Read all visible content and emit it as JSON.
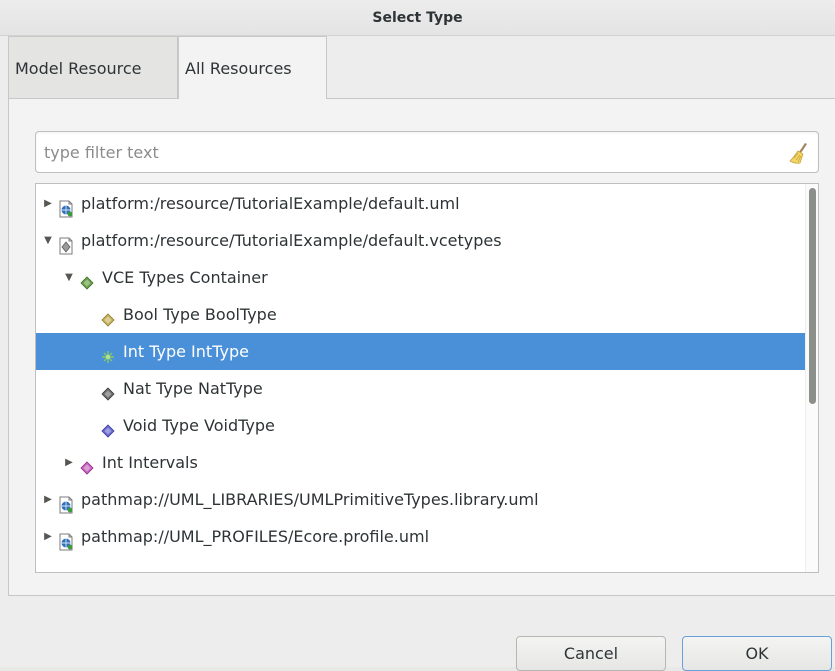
{
  "window": {
    "title": "Select Type"
  },
  "tabs": [
    {
      "label": "Model Resource",
      "active": false
    },
    {
      "label": "All Resources",
      "active": true
    }
  ],
  "filter": {
    "placeholder": "type filter text",
    "value": ""
  },
  "tree": {
    "rows": [
      {
        "label": "platform:/resource/TutorialExample/default.uml",
        "depth": 0,
        "expander": "collapsed",
        "icon": "uml-resource-icon"
      },
      {
        "label": "platform:/resource/TutorialExample/default.vcetypes",
        "depth": 0,
        "expander": "expanded",
        "icon": "vcetypes-resource-icon"
      },
      {
        "label": "VCE Types Container",
        "depth": 1,
        "expander": "expanded",
        "icon": "types-container-icon"
      },
      {
        "label": "Bool Type BoolType",
        "depth": 2,
        "expander": "none",
        "icon": "bool-type-icon"
      },
      {
        "label": "Int Type IntType",
        "depth": 2,
        "expander": "none",
        "icon": "int-type-icon",
        "selected": true
      },
      {
        "label": "Nat Type NatType",
        "depth": 2,
        "expander": "none",
        "icon": "nat-type-icon"
      },
      {
        "label": "Void Type VoidType",
        "depth": 2,
        "expander": "none",
        "icon": "void-type-icon"
      },
      {
        "label": "Int Intervals",
        "depth": 1,
        "expander": "collapsed",
        "icon": "int-intervals-icon"
      },
      {
        "label": "pathmap://UML_LIBRARIES/UMLPrimitiveTypes.library.uml",
        "depth": 0,
        "expander": "collapsed",
        "icon": "uml-resource-icon"
      },
      {
        "label": "pathmap://UML_PROFILES/Ecore.profile.uml",
        "depth": 0,
        "expander": "collapsed",
        "icon": "uml-resource-icon"
      }
    ]
  },
  "buttons": {
    "cancel": "Cancel",
    "ok": "OK"
  },
  "colors": {
    "selection": "#4a90d9",
    "accent": "#4a90d9"
  }
}
